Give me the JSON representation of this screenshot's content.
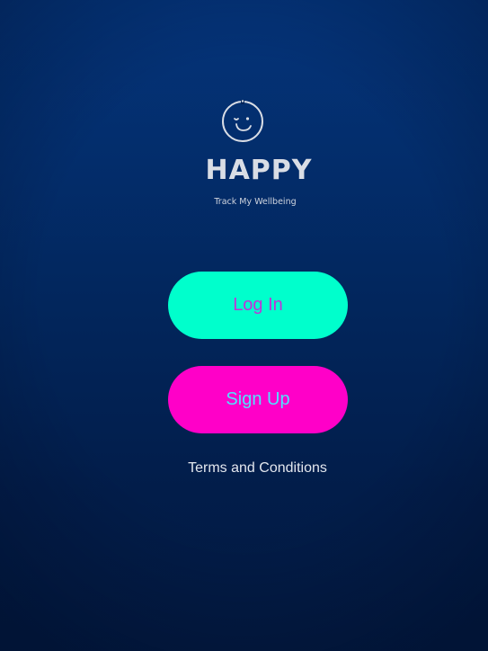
{
  "app": {
    "name": "HAPPY",
    "tagline": "Track My Wellbeing",
    "logo_icon": "winking-face-icon"
  },
  "actions": {
    "login_label": "Log In",
    "signup_label": "Sign Up",
    "terms_label": "Terms and Conditions"
  },
  "colors": {
    "background_top": "#04347a",
    "background_bottom": "#021a42",
    "login_button_bg": "#00ffcc",
    "login_button_text": "#c231d8",
    "signup_button_bg": "#ff00c8",
    "signup_button_text": "#4fe3ff",
    "logo_color": "#d9dde5"
  }
}
